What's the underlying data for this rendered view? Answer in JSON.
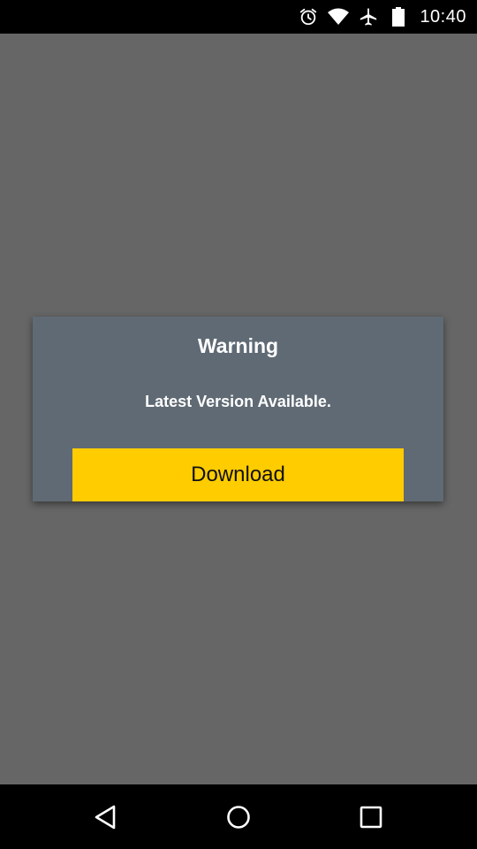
{
  "status_bar": {
    "time": "10:40",
    "icons": [
      "alarm-icon",
      "wifi-icon",
      "airplane-mode-icon",
      "battery-icon"
    ]
  },
  "dialog": {
    "title": "Warning",
    "message": "Latest Version Available.",
    "button_label": "Download"
  },
  "nav_bar": {
    "buttons": [
      "back-icon",
      "home-icon",
      "recents-icon"
    ]
  },
  "colors": {
    "background_dim": "#666666",
    "dialog_background": "#5f6a74",
    "button_accent": "#ffcc00",
    "bars": "#000000"
  }
}
